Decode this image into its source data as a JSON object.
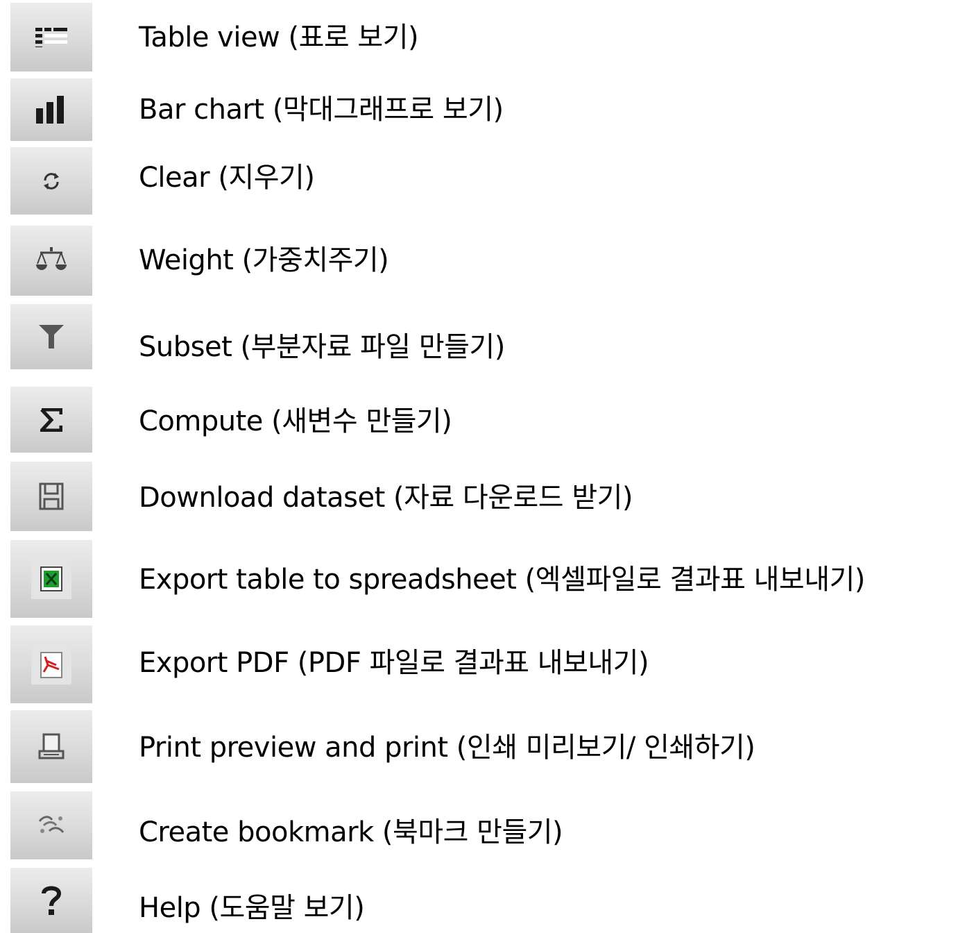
{
  "colors": {
    "button_top": "#ececec",
    "button_bottom": "#c9c9c9",
    "icon_dark": "#1a1a1a",
    "icon_gray": "#666666",
    "excel_green": "#1f9e2f",
    "pdf_red": "#d61f1f",
    "text": "#000000"
  },
  "legend": {
    "items": [
      {
        "icon": "table-view-icon",
        "label": "Table view (표로 보기)"
      },
      {
        "icon": "bar-chart-icon",
        "label": "Bar chart (막대그래프로 보기)"
      },
      {
        "icon": "clear-icon",
        "label": "Clear (지우기)"
      },
      {
        "icon": "weight-scale-icon",
        "label": "Weight (가중치주기)"
      },
      {
        "icon": "filter-icon",
        "label": "Subset (부분자료 파일 만들기)"
      },
      {
        "icon": "sigma-icon",
        "label": "Compute (새변수 만들기)"
      },
      {
        "icon": "floppy-disk-icon",
        "label": "Download dataset (자료 다운로드 받기)"
      },
      {
        "icon": "excel-icon",
        "label": "Export table to spreadsheet (엑셀파일로 결과표 내보내기)"
      },
      {
        "icon": "pdf-icon",
        "label": "Export PDF (PDF 파일로 결과표 내보내기)"
      },
      {
        "icon": "printer-icon",
        "label": "Print preview and print (인쇄 미리보기/ 인쇄하기)"
      },
      {
        "icon": "bookmark-icon",
        "label": "Create bookmark (북마크 만들기)"
      },
      {
        "icon": "help-icon",
        "label": "Help (도움말 보기)"
      }
    ]
  }
}
